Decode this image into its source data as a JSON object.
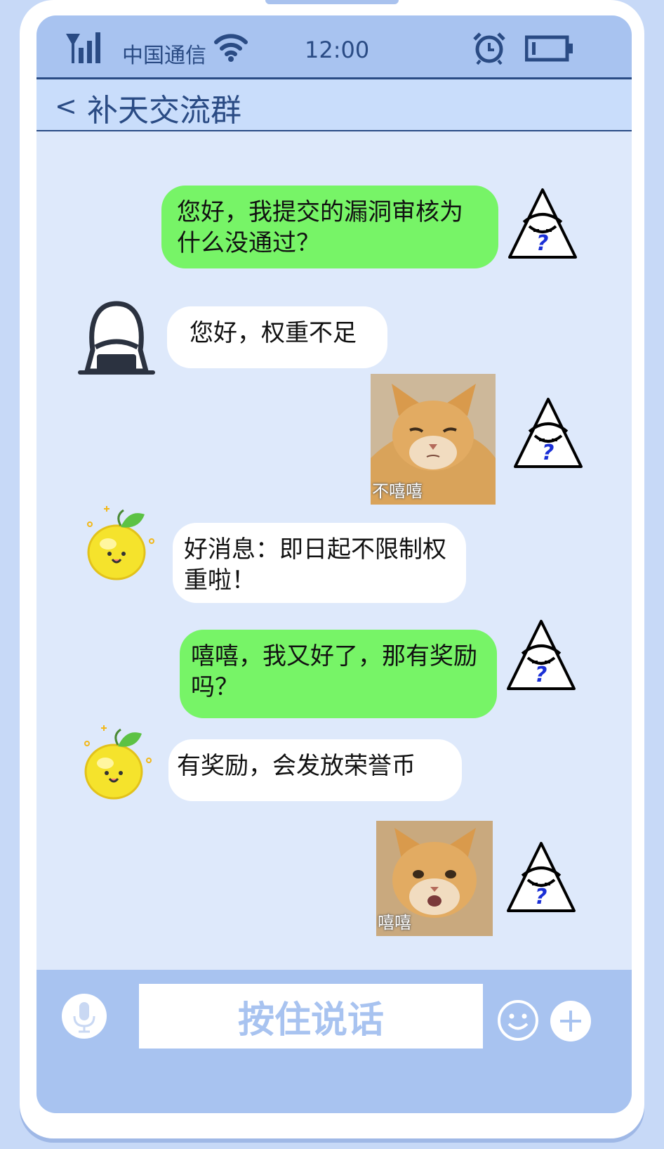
{
  "status_bar": {
    "carrier": "中国通信",
    "time": "12:00"
  },
  "nav": {
    "back": "<",
    "title": "补天交流群"
  },
  "messages": [
    {
      "side": "right",
      "type": "text",
      "color": "green",
      "avatar": "hooded-question-avatar",
      "text": "您好，我提交的漏洞审核为什么没通过？"
    },
    {
      "side": "left",
      "type": "text",
      "color": "white",
      "avatar": "hooded-dark-avatar",
      "text": "您好，权重不足"
    },
    {
      "side": "right",
      "type": "sticker",
      "avatar": "hooded-question-avatar",
      "caption": "不嘻嘻"
    },
    {
      "side": "left",
      "type": "text",
      "color": "white",
      "avatar": "lemon-avatar",
      "text": "好消息：即日起不限制权重啦！"
    },
    {
      "side": "right",
      "type": "text",
      "color": "green",
      "avatar": "hooded-question-avatar",
      "text": "嘻嘻，我又好了，那有奖励吗？"
    },
    {
      "side": "left",
      "type": "text",
      "color": "white",
      "avatar": "lemon-avatar",
      "text": "有奖励，会发放荣誉币"
    },
    {
      "side": "right",
      "type": "sticker",
      "avatar": "hooded-question-avatar",
      "caption": "嘻嘻"
    }
  ],
  "input_bar": {
    "voice_label": "按住说话",
    "icons": [
      "microphone-icon",
      "emoji-icon",
      "plus-icon"
    ]
  },
  "colors": {
    "accent_dark": "#2a4b84",
    "header_bg": "#a8c3f0",
    "chat_bg": "#dee9fb",
    "bubble_green": "#77f467",
    "bubble_white": "#ffffff",
    "question_mark": "#1a2fd6"
  }
}
